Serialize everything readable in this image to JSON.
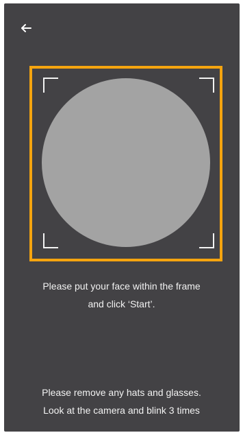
{
  "header": {
    "back_icon": "arrow-left-icon"
  },
  "colors": {
    "background": "#434245",
    "frame_accent": "#f5a40f",
    "face_placeholder": "#a3a3a3",
    "text": "#f2f2f2"
  },
  "capture": {
    "frame_icon": "corner-brackets",
    "face_placeholder_icon": "circle"
  },
  "instructions": {
    "frame_line1": "Please put your face within the frame",
    "frame_line2": "and click ‘Start’.",
    "tips_line1": "Please remove any hats and glasses.",
    "tips_line2": "Look at the camera and blink 3 times"
  }
}
